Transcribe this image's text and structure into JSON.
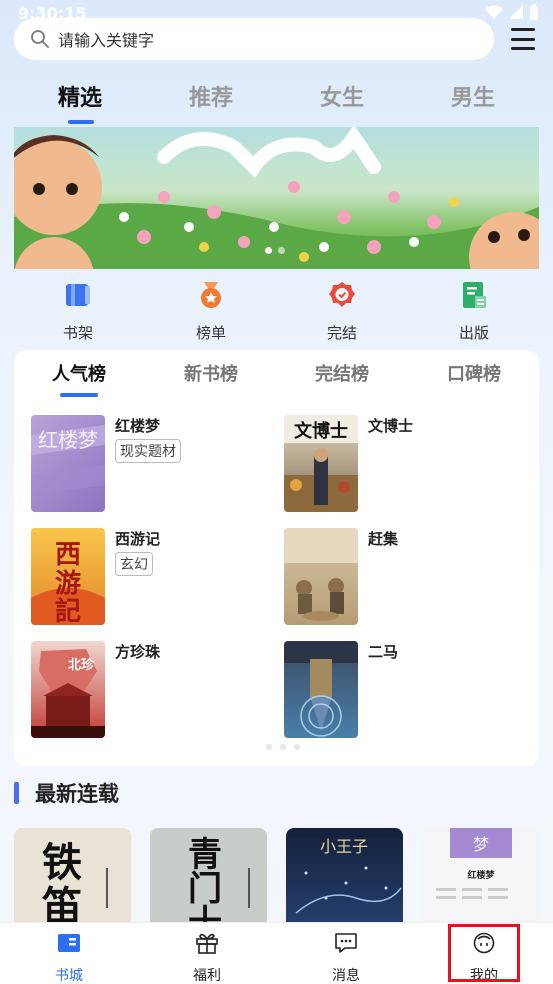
{
  "status": {
    "time": "9:30:15"
  },
  "search": {
    "placeholder": "请输入关键字"
  },
  "top_tabs": [
    {
      "label": "精选",
      "active": true
    },
    {
      "label": "推荐",
      "active": false
    },
    {
      "label": "女生",
      "active": false
    },
    {
      "label": "男生",
      "active": false
    }
  ],
  "quick_links": [
    {
      "label": "书架",
      "icon": "bookshelf-icon"
    },
    {
      "label": "榜单",
      "icon": "medal-icon"
    },
    {
      "label": "完结",
      "icon": "badge-check-icon"
    },
    {
      "label": "出版",
      "icon": "publish-book-icon"
    }
  ],
  "rank_tabs": [
    {
      "label": "人气榜",
      "active": true
    },
    {
      "label": "新书榜",
      "active": false
    },
    {
      "label": "完结榜",
      "active": false
    },
    {
      "label": "口碑榜",
      "active": false
    }
  ],
  "rank_books": [
    {
      "title": "红楼梦",
      "tag": "现实题材",
      "cover_text": "红楼梦"
    },
    {
      "title": "文博士",
      "tag": "",
      "cover_text": "文博士"
    },
    {
      "title": "西游记",
      "tag": "玄幻",
      "cover_text": "西游記"
    },
    {
      "title": "赶集",
      "tag": "",
      "cover_text": ""
    },
    {
      "title": "方珍珠",
      "tag": "",
      "cover_text": "北珍"
    },
    {
      "title": "二马",
      "tag": "",
      "cover_text": ""
    }
  ],
  "section": {
    "title": "最新连载"
  },
  "serial_books": [
    {
      "cover_text": "铁笛"
    },
    {
      "cover_text": "青门十四"
    },
    {
      "cover_text": "小王子"
    },
    {
      "cover_text": "红楼梦"
    }
  ],
  "bottom_nav": [
    {
      "label": "书城",
      "icon": "bookstore-icon",
      "active": true
    },
    {
      "label": "福利",
      "icon": "gift-icon",
      "active": false
    },
    {
      "label": "消息",
      "icon": "message-icon",
      "active": false
    },
    {
      "label": "我的",
      "icon": "profile-face-icon",
      "active": false
    }
  ],
  "colors": {
    "accent": "#2e6ef0",
    "highlight": "#e8121f"
  }
}
